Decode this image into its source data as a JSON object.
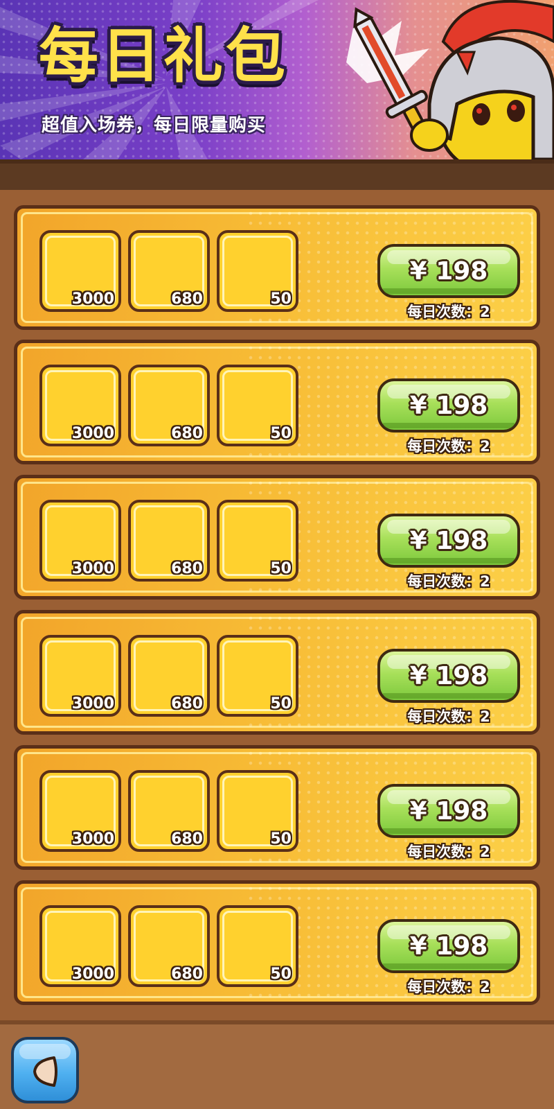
{
  "banner": {
    "title": "每日礼包",
    "subtitle": "超值入场券，每日限量购买"
  },
  "packs": [
    {
      "items": [
        {
          "count": "3000"
        },
        {
          "count": "680"
        },
        {
          "count": "50"
        }
      ],
      "price": "¥ 198",
      "limit": "每日次数：2"
    },
    {
      "items": [
        {
          "count": "3000"
        },
        {
          "count": "680"
        },
        {
          "count": "50"
        }
      ],
      "price": "¥ 198",
      "limit": "每日次数：2"
    },
    {
      "items": [
        {
          "count": "3000"
        },
        {
          "count": "680"
        },
        {
          "count": "50"
        }
      ],
      "price": "¥ 198",
      "limit": "每日次数：2"
    },
    {
      "items": [
        {
          "count": "3000"
        },
        {
          "count": "680"
        },
        {
          "count": "50"
        }
      ],
      "price": "¥ 198",
      "limit": "每日次数：2"
    },
    {
      "items": [
        {
          "count": "3000"
        },
        {
          "count": "680"
        },
        {
          "count": "50"
        }
      ],
      "price": "¥ 198",
      "limit": "每日次数：2"
    },
    {
      "items": [
        {
          "count": "3000"
        },
        {
          "count": "680"
        },
        {
          "count": "50"
        }
      ],
      "price": "¥ 198",
      "limit": "每日次数：2"
    }
  ],
  "icons": {
    "back": "back-arrow-icon",
    "mascot": "spartan-warrior-mascot"
  },
  "colors": {
    "buy_button": "#a8e05a",
    "row_fill": "#f7bb35",
    "item_slot": "#ffd12e",
    "back_button": "#4fb0f0"
  }
}
